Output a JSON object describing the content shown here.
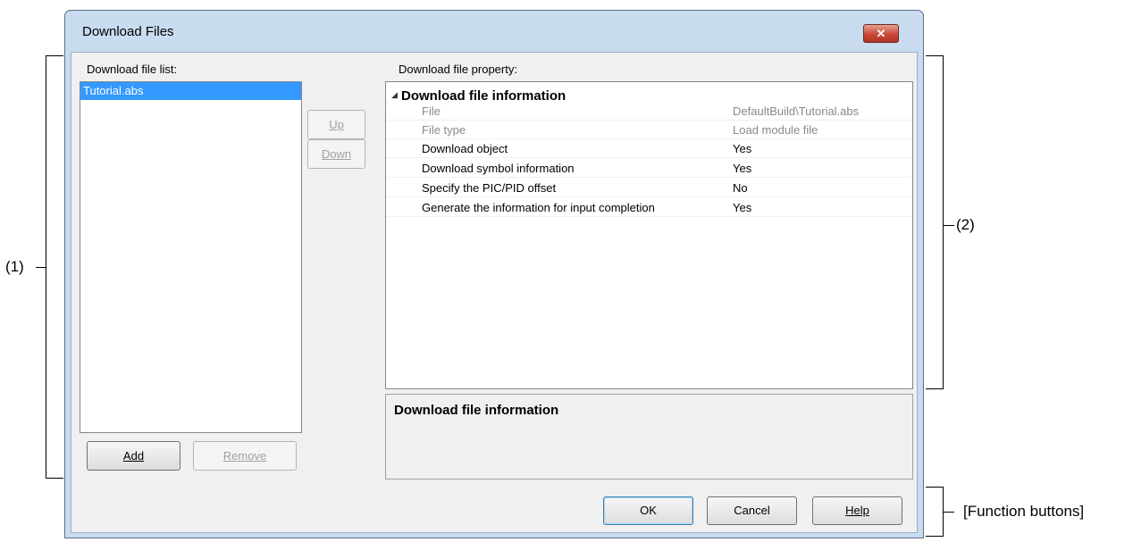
{
  "window": {
    "title": "Download Files",
    "close_glyph": "✕"
  },
  "left": {
    "list_label": "Download file list:",
    "items": [
      {
        "label": "Tutorial.abs",
        "selected": true
      }
    ],
    "up_button": "Up",
    "down_button": "Down",
    "add_button": "Add",
    "remove_button": "Remove"
  },
  "right": {
    "property_label": "Download file property:",
    "category": "Download file information",
    "properties": [
      {
        "name": "File",
        "value": "DefaultBuild\\Tutorial.abs",
        "readonly": true
      },
      {
        "name": "File type",
        "value": "Load module file",
        "readonly": true
      },
      {
        "name": "Download object",
        "value": "Yes",
        "readonly": false
      },
      {
        "name": "Download symbol information",
        "value": "Yes",
        "readonly": false
      },
      {
        "name": "Specify the PIC/PID offset",
        "value": "No",
        "readonly": false
      },
      {
        "name": "Generate the information for input completion",
        "value": "Yes",
        "readonly": false
      }
    ],
    "description_title": "Download file information"
  },
  "footer": {
    "ok": "OK",
    "cancel": "Cancel",
    "help": "Help"
  },
  "annotations": {
    "left": "(1)",
    "right": "(2)",
    "function": "[Function buttons]"
  }
}
